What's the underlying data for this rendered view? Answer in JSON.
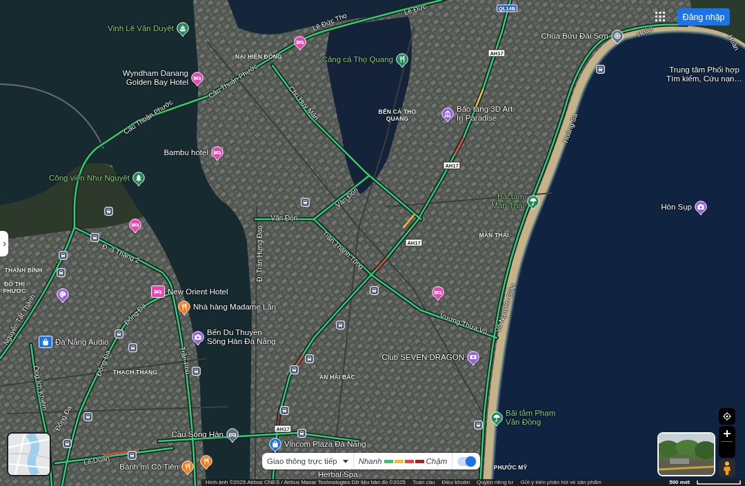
{
  "top_bar": {
    "sign_in": "Đăng nhập"
  },
  "map": {
    "places": [
      {
        "label": "Vịnh Lê Văn Duyệt",
        "kind": "ferry"
      },
      {
        "kind": "hotel"
      },
      {
        "label": "Chùa Bửu Đài Sơn",
        "kind": "temple"
      },
      {
        "label": "Cảng cá Thọ Quang",
        "kind": "port"
      },
      {
        "label": "Wyndham Danang Golden Bay Hotel",
        "kind": "hotel"
      },
      {
        "label": "Bảo tàng 3D Art In Paradise",
        "kind": "museum"
      },
      {
        "label": "Trung tâm Phối hợp Tìm kiếm, Cứu nạn…",
        "kind": "agency"
      },
      {
        "label": "Bambu hotel",
        "kind": "hotel"
      },
      {
        "label": "Công viên Như Nguyệt",
        "kind": "park"
      },
      {
        "label": "Bãi tắm Mân Thái",
        "kind": "beach"
      },
      {
        "label": "Hòn Sụp",
        "kind": "attraction"
      },
      {
        "kind": "hotel"
      },
      {
        "kind": "art"
      },
      {
        "label": "New Orient Hotel",
        "kind": "hoteltile"
      },
      {
        "kind": "hotel"
      },
      {
        "label": "Nhà hàng Madame Lân",
        "kind": "restaurant"
      },
      {
        "label": "Đà Nẵng Audio",
        "kind": "shoptile"
      },
      {
        "label": "Bến Du Thuyền Sông Hàn Đà Nẵng",
        "kind": "attraction"
      },
      {
        "label": "Club SEVEN DRAGON",
        "kind": "club"
      },
      {
        "label": "Bãi tắm Phạm Văn Đồng",
        "kind": "beach"
      },
      {
        "label": "Cầu Sông Hàn",
        "kind": "bridge"
      },
      {
        "label": "Vincom Plaza Đà Nẵng",
        "kind": "shop"
      },
      {
        "kind": "restaurant"
      },
      {
        "label": "Bánh mì Cô Tiên",
        "kind": "restaurant"
      },
      {
        "label": "Herbal Spa",
        "kind": "spa"
      }
    ],
    "areas": [
      "NẠI HIÊN ĐÔNG",
      "BẾN CÁ THỌ QUANG",
      "MÂN THÁI",
      "THANH BÌNH",
      "ĐÔ THỊ PHƯỚC",
      "THẠCH THANG",
      "AN HẢI BẮC",
      "PHƯỚC MỸ"
    ],
    "roads": [
      "Lê Đức",
      "Lê Đức Thọ",
      "Hoàn",
      "Hoàn",
      "Cầu Thuận Phước",
      "Chu Huy Mân",
      "Cầu Thuận Phước",
      "Hoàng Sa",
      "Vân Đồn",
      "Vân Đồn",
      "Trần Thánh Tông",
      "Đ. Trần Hưng Đạo",
      "Đ. 3 Tháng 2",
      "Võ Nguyên Giáp",
      "Đống Đa",
      "Nguyễn Tất Thành",
      "Vương Thừa Vũ",
      "Trần Phú",
      "Đống Đa",
      "Ông Ích Khiêm",
      "Đống Đa",
      "Lê Duẩn"
    ],
    "route_shields": [
      {
        "label": "QL14B",
        "kind": "national"
      },
      {
        "label": "AH17",
        "kind": "asian"
      },
      {
        "label": "AH17",
        "kind": "asian"
      },
      {
        "label": "AH17",
        "kind": "asian"
      },
      {
        "label": "AH17",
        "kind": "asian"
      }
    ]
  },
  "traffic_legend": {
    "mode": "Giao thông trực tiếp",
    "fast_label": "Nhanh",
    "speeds": [
      {
        "color": "#3ec27a"
      },
      {
        "color": "#f5bb3a"
      },
      {
        "color": "#e6463e"
      },
      {
        "color": "#a0262a"
      }
    ],
    "slow_label": "Chậm",
    "on": true
  },
  "attribution": {
    "credits": "Hình ảnh ©2025 Airbus CNES / Airbus Maxar Technologies Dữ liệu bản đồ ©2025",
    "links": [
      "Toàn cầu",
      "Điều khoản",
      "Quyền riêng tư",
      "Gửi ý kiến phản hồi về sản phẩm"
    ],
    "scale": "500 mét"
  }
}
